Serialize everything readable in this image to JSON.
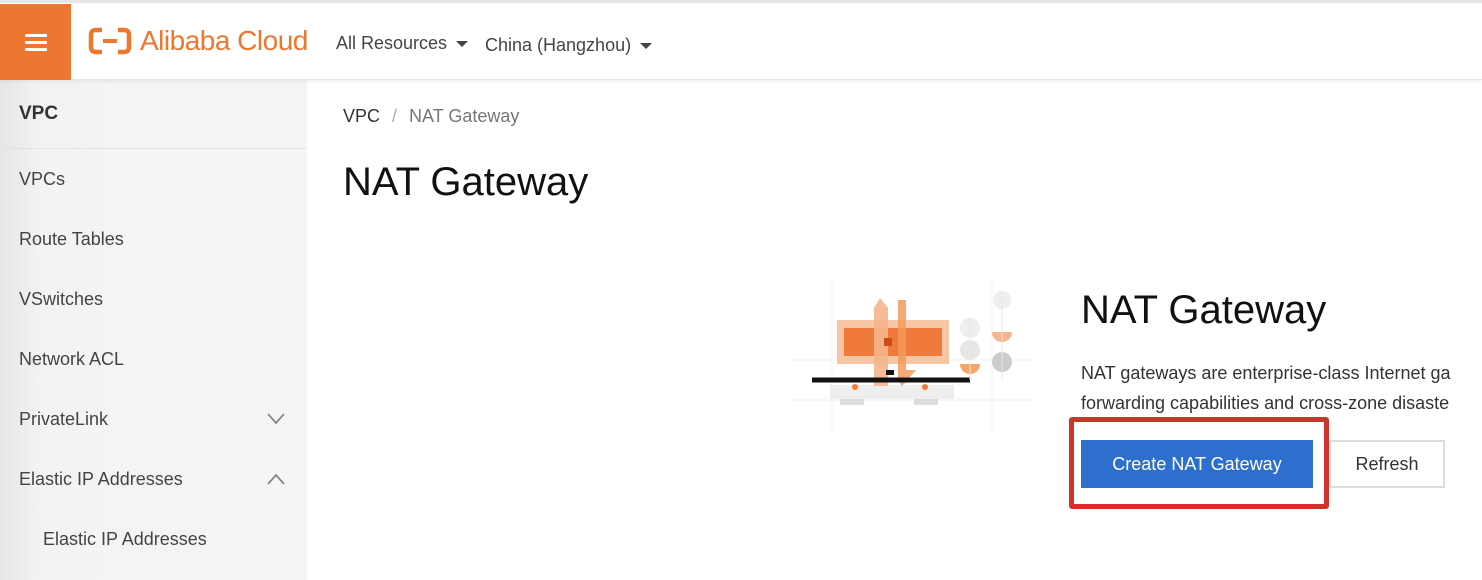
{
  "topbar": {
    "menu_icon": "hamburger-menu-icon",
    "brand": "Alibaba Cloud",
    "brand_color": "#ed7730",
    "resources_label": "All Resources",
    "region_label": "China (Hangzhou)"
  },
  "sidebar": {
    "title": "VPC",
    "items": [
      {
        "label": "VPCs"
      },
      {
        "label": "Route Tables"
      },
      {
        "label": "VSwitches"
      },
      {
        "label": "Network ACL"
      },
      {
        "label": "PrivateLink",
        "icon": "chevron-down-icon"
      },
      {
        "label": "Elastic IP Addresses",
        "icon": "chevron-up-icon"
      },
      {
        "label": "Elastic IP Addresses"
      }
    ]
  },
  "main": {
    "breadcrumb": {
      "root": "VPC",
      "separator": "/",
      "current": "NAT Gateway"
    },
    "title": "NAT Gateway",
    "empty_state": {
      "illustration": "nat-gateway-illustration",
      "title": "NAT Gateway",
      "description_line1": "NAT gateways are enterprise-class Internet ga",
      "description_line2": "forwarding capabilities and cross-zone disaste",
      "primary_button": "Create NAT Gateway",
      "secondary_button": "Refresh",
      "primary_color": "#2d6fcf",
      "highlight_color": "#d2322a"
    }
  }
}
